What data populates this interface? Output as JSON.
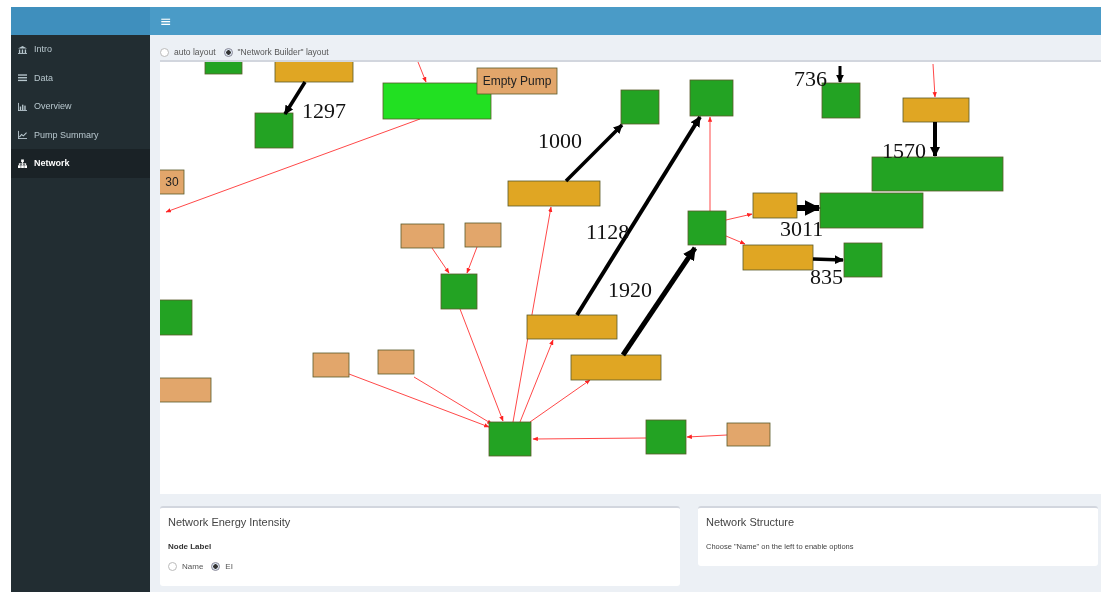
{
  "header": {
    "menu_toggle": "≡"
  },
  "sidebar": {
    "items": [
      {
        "label": "Intro",
        "selected": false
      },
      {
        "label": "Data",
        "selected": false
      },
      {
        "label": "Overview",
        "selected": false
      },
      {
        "label": "Pump Summary",
        "selected": false
      },
      {
        "label": "Network",
        "selected": true
      }
    ]
  },
  "layout_options": [
    {
      "label": "auto layout",
      "selected": false
    },
    {
      "label": "\"Network Builder\" layout",
      "selected": true
    }
  ],
  "network": {
    "nodes": [
      {
        "kind": "plant"
      },
      {
        "kind": "pump"
      },
      {
        "kind": "plant"
      },
      {
        "kind": "highlight"
      },
      {
        "kind": "source",
        "label": "Empty Pump"
      },
      {
        "kind": "plant"
      },
      {
        "kind": "plant"
      },
      {
        "kind": "plant"
      },
      {
        "kind": "pump"
      },
      {
        "kind": "plant"
      },
      {
        "kind": "source",
        "label": "30"
      },
      {
        "kind": "pump"
      },
      {
        "kind": "source"
      },
      {
        "kind": "source"
      },
      {
        "kind": "plant"
      },
      {
        "kind": "plant"
      },
      {
        "kind": "pump"
      },
      {
        "kind": "plant"
      },
      {
        "kind": "pump"
      },
      {
        "kind": "plant"
      },
      {
        "kind": "plant"
      },
      {
        "kind": "source"
      },
      {
        "kind": "pump"
      },
      {
        "kind": "source"
      },
      {
        "kind": "source"
      },
      {
        "kind": "pump"
      },
      {
        "kind": "plant"
      },
      {
        "kind": "plant"
      },
      {
        "kind": "source"
      }
    ],
    "edges": [
      {
        "kind": "flow",
        "label": "1297"
      },
      {
        "kind": "flow",
        "label": "1000"
      },
      {
        "kind": "flow",
        "label": "1128"
      },
      {
        "kind": "flow",
        "label": "1920"
      },
      {
        "kind": "flow",
        "label": "736"
      },
      {
        "kind": "flow",
        "label": "1570"
      },
      {
        "kind": "flow",
        "label": "3011"
      },
      {
        "kind": "flow",
        "label": "835"
      },
      {
        "kind": "link"
      },
      {
        "kind": "link"
      },
      {
        "kind": "link"
      },
      {
        "kind": "link"
      },
      {
        "kind": "link"
      },
      {
        "kind": "link"
      },
      {
        "kind": "link"
      },
      {
        "kind": "link"
      },
      {
        "kind": "link"
      },
      {
        "kind": "link"
      },
      {
        "kind": "link"
      },
      {
        "kind": "link"
      },
      {
        "kind": "link"
      },
      {
        "kind": "link"
      },
      {
        "kind": "link"
      },
      {
        "kind": "link"
      }
    ]
  },
  "boxes": [
    {
      "title": "Network Energy Intensity",
      "field_label": "Node Label",
      "options": [
        {
          "label": "Name",
          "selected": false
        },
        {
          "label": "EI",
          "selected": true
        }
      ]
    },
    {
      "title": "Network Structure",
      "note": "Choose \"Name\" on the left to enable options"
    }
  ]
}
